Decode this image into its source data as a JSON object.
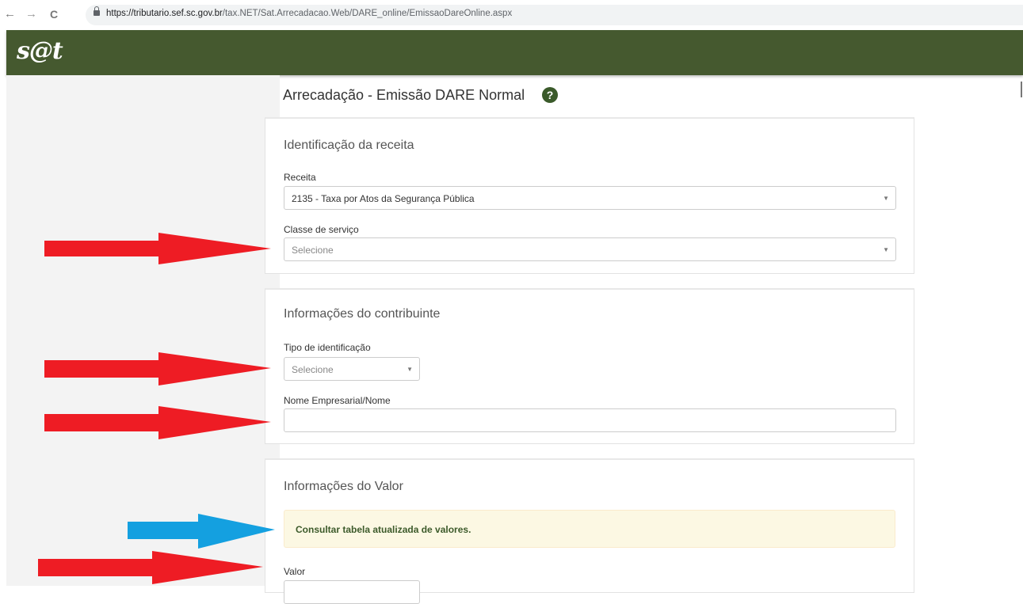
{
  "browser": {
    "back_icon": "←",
    "forward_icon": "→",
    "reload_icon": "C",
    "url_host": "https://tributario.sef.sc.gov.br",
    "url_path": "/tax.NET/Sat.Arrecadacao.Web/DARE_online/EmissaoDareOnline.aspx"
  },
  "header": {
    "logo": "s@t",
    "bg_color": "#45592f"
  },
  "page": {
    "title": "Arrecadação - Emissão DARE Normal",
    "help_icon": "?"
  },
  "sections": {
    "receita": {
      "title": "Identificação da receita",
      "receita_label": "Receita",
      "receita_value": "2135 - Taxa por Atos da Segurança Pública",
      "classe_label": "Classe de serviço",
      "classe_placeholder": "Selecione"
    },
    "contribuinte": {
      "title": "Informações do contribuinte",
      "tipo_label": "Tipo de identificação",
      "tipo_placeholder": "Selecione",
      "nome_label": "Nome Empresarial/Nome",
      "nome_value": ""
    },
    "valor": {
      "title": "Informações do Valor",
      "alert_text": "Consultar tabela atualizada de valores.",
      "valor_label": "Valor"
    }
  },
  "annotations": {
    "red_arrow_color": "#ee1c24",
    "blue_arrow_color": "#14a0e0"
  }
}
